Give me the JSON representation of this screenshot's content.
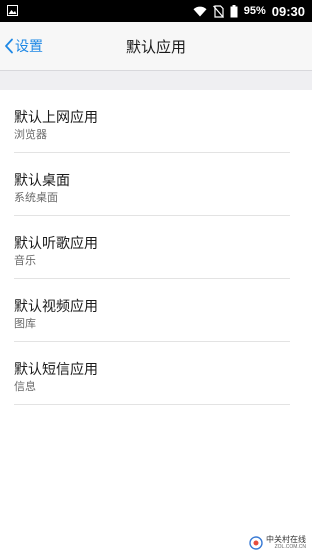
{
  "status_bar": {
    "battery_percent": "95%",
    "time": "09:30"
  },
  "nav": {
    "back_label": "设置",
    "title": "默认应用"
  },
  "rows": [
    {
      "primary": "默认上网应用",
      "secondary": "浏览器"
    },
    {
      "primary": "默认桌面",
      "secondary": "系统桌面"
    },
    {
      "primary": "默认听歌应用",
      "secondary": "音乐"
    },
    {
      "primary": "默认视频应用",
      "secondary": "图库"
    },
    {
      "primary": "默认短信应用",
      "secondary": "信息"
    }
  ],
  "watermark": {
    "cn": "中关村在线",
    "en": "ZOL.COM.CN"
  },
  "colors": {
    "accent": "#1e88e5",
    "status_bar": "#000000",
    "band": "#efeff2"
  }
}
